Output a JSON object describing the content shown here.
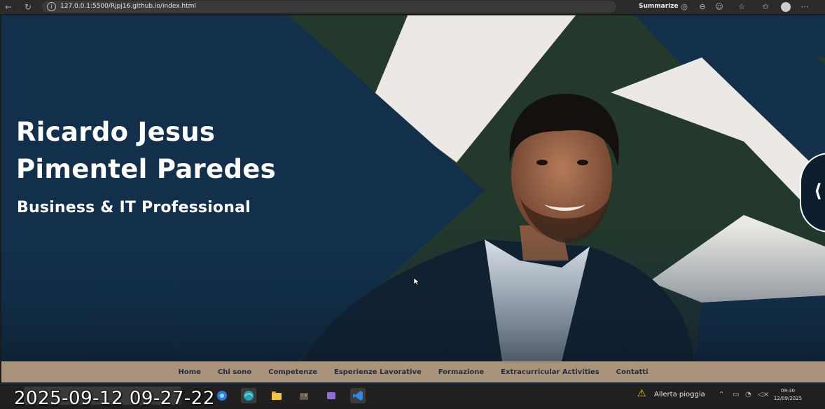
{
  "browser": {
    "url": "127.0.0.1:5500/Rjpj16.github.io/index.html",
    "summarize_label": "Summarize"
  },
  "hero": {
    "title": "Ricardo Jesus\nPimentel Paredes",
    "subtitle": "Business & IT Professional"
  },
  "nav": {
    "items": [
      "Home",
      "Chi sono",
      "Competenze",
      "Esperienze Lavorative",
      "Formazione",
      "Extracurricular Activities",
      "Contatti"
    ]
  },
  "taskbar": {
    "weather": "Allerta pioggia",
    "time": "09:30",
    "date": "12/09/2025"
  },
  "overlay": {
    "timestamp": "2025-09-12 09-27-22"
  },
  "colors": {
    "hero_bg": "#12304b",
    "accent_green": "#2e4a32",
    "navbar_bg": "#a9937b",
    "nav_text": "#1f2c44"
  },
  "icons": {
    "back": "arrow-left-icon",
    "reload": "reload-icon",
    "info": "info-icon",
    "side_toggle": "code-brackets-icon"
  }
}
